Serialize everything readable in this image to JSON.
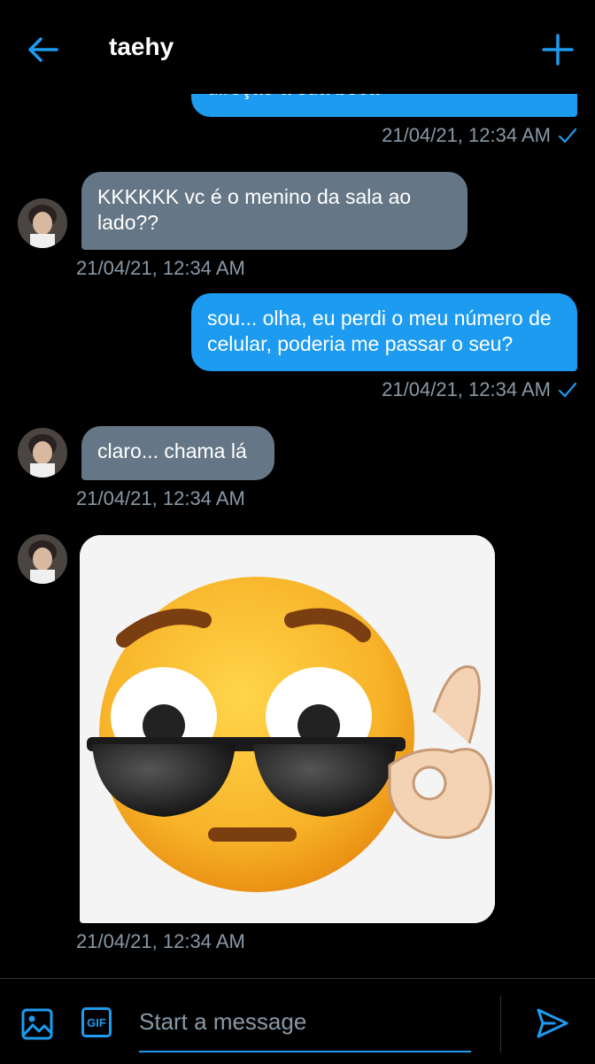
{
  "header": {
    "title": "taehy",
    "back_icon": "arrow-left-icon",
    "new_icon": "plus-icon",
    "accent": "#1d9bf0"
  },
  "messages": [
    {
      "direction": "out",
      "text": "direção a sua boca",
      "time": "21/04/21, 12:34 AM",
      "read": true
    },
    {
      "direction": "in",
      "text": "KKKKKK vc é o menino da sala ao lado??",
      "time": "21/04/21, 12:34 AM"
    },
    {
      "direction": "out",
      "text": "sou... olha, eu perdi o meu número de celular, poderia me passar o seu?",
      "time": "21/04/21, 12:34 AM",
      "read": true
    },
    {
      "direction": "in",
      "text": "claro... chama lá",
      "time": "21/04/21, 12:34 AM"
    },
    {
      "direction": "in",
      "type": "image",
      "image_icon": "sunglasses-emoji",
      "time": "21/04/21, 12:34 AM"
    }
  ],
  "composer": {
    "placeholder": "Start a message",
    "media_icon": "image-icon",
    "gif_label": "GIF",
    "send_icon": "send-icon"
  },
  "colors": {
    "outgoing_bubble": "#1d9bf0",
    "incoming_bubble": "#657786",
    "timestamp": "#8899a6",
    "background": "#000000"
  }
}
